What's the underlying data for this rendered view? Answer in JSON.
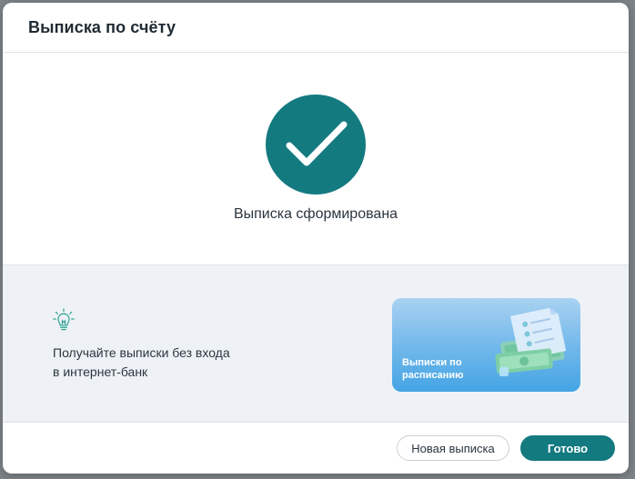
{
  "dialog": {
    "title": "Выписка по счёту"
  },
  "success": {
    "icon": "checkmark-icon",
    "message": "Выписка сформирована"
  },
  "promo": {
    "icon": "lightbulb-icon",
    "text": "Получайте выписки без входа в интернет-банк",
    "banner_label": "Выписки по расписанию"
  },
  "footer": {
    "new_statement_label": "Новая выписка",
    "done_label": "Готово"
  },
  "colors": {
    "accent": "#137a80",
    "banner_gradient_top": "#a9d2f2",
    "banner_gradient_bottom": "#44a4e4",
    "promo_background": "#eef2f6"
  }
}
